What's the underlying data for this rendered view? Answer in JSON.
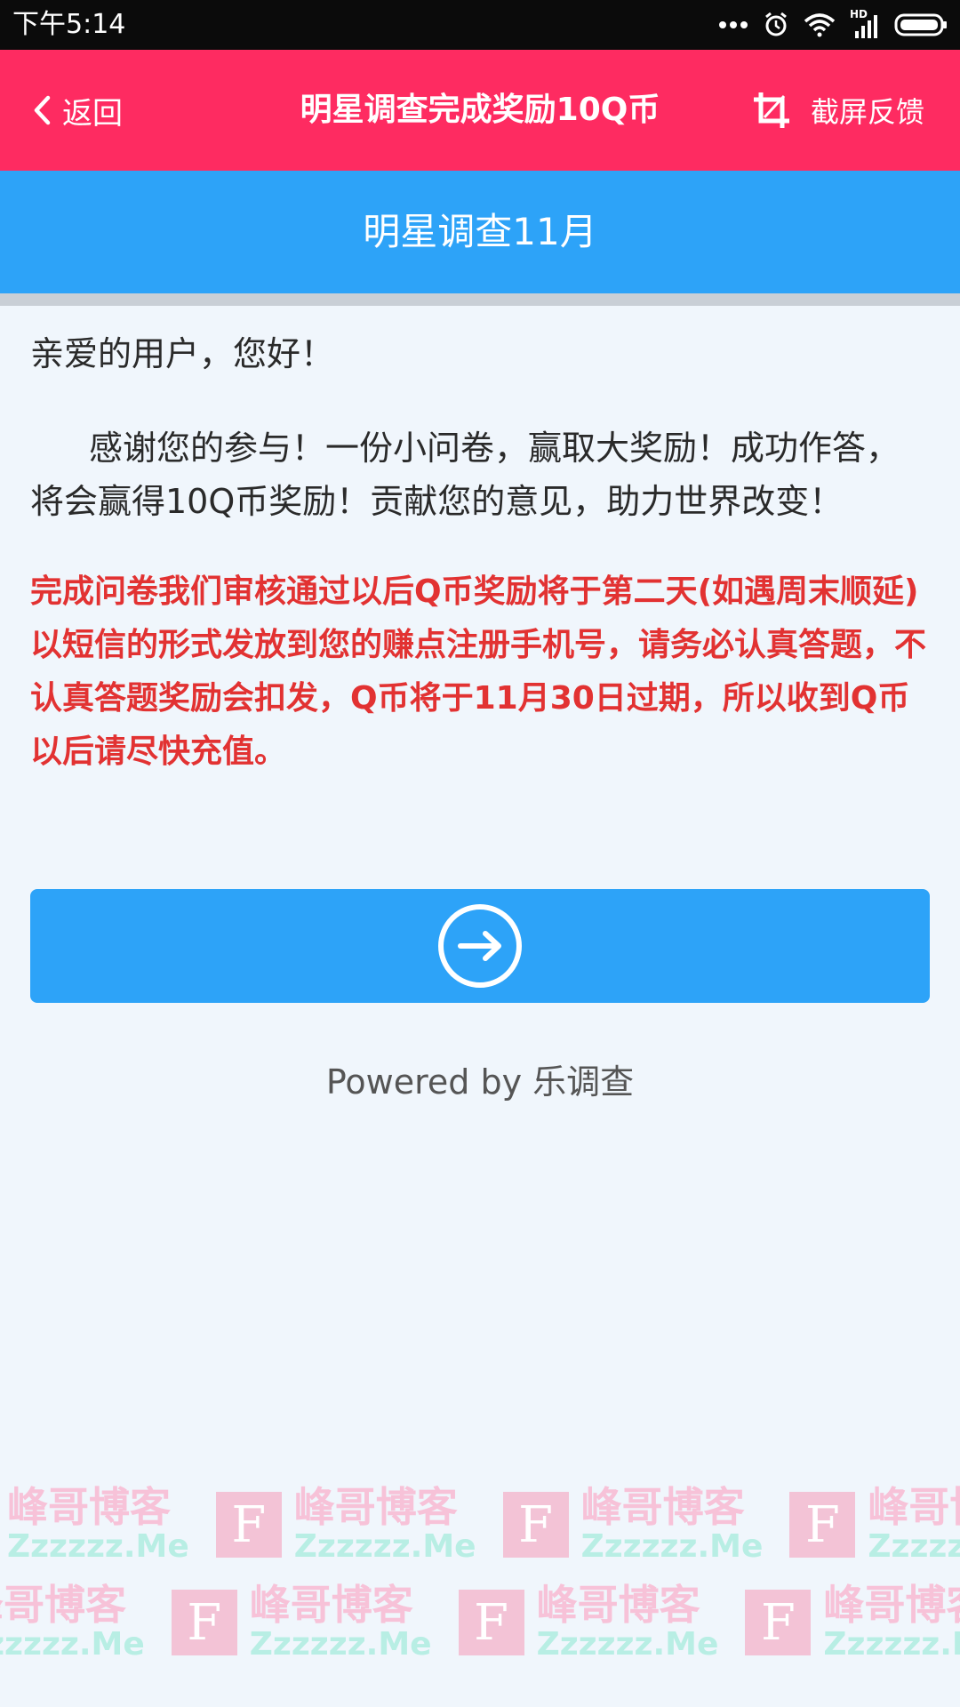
{
  "status_bar": {
    "time": "下午5:14",
    "hd_label": "HD",
    "icons": [
      "more-dots-icon",
      "alarm-icon",
      "wifi-icon",
      "signal-icon",
      "battery-icon"
    ]
  },
  "header": {
    "back_label": "返回",
    "title": "明星调查完成奖励10Q币",
    "feedback_label": "截屏反馈",
    "color": "#fe2b61"
  },
  "survey": {
    "title": "明星调查11月",
    "color": "#2da3f8"
  },
  "content": {
    "greeting": "亲爱的用户，您好！",
    "intro": "感谢您的参与！一份小问卷，赢取大奖励！成功作答，将会赢得10Q币奖励！贡献您的意见，助力世界改变！",
    "notice": "完成问卷我们审核通过以后Q币奖励将于第二天(如遇周末顺延)以短信的形式发放到您的赚点注册手机号，请务必认真答题，不认真答题奖励会扣发，Q币将于11月30日过期，所以收到Q币以后请尽快充值。",
    "notice_color": "#e23232"
  },
  "next_button": {
    "icon": "arrow-right-circle-icon"
  },
  "footer": {
    "powered_by": "Powered by 乐调查"
  },
  "watermark": {
    "logo_letter": "F",
    "name": "峰哥博客",
    "url": "Zzzzzz.Me"
  }
}
